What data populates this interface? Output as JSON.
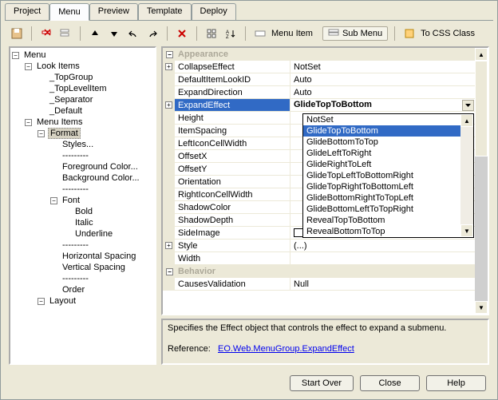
{
  "tabs": [
    "Project",
    "Menu",
    "Preview",
    "Template",
    "Deploy"
  ],
  "activeTab": 1,
  "toolbar": {
    "menuItem": "Menu Item",
    "subMenu": "Sub Menu",
    "toCssClass": "To CSS Class"
  },
  "tree": {
    "root": "Menu",
    "lookItems": {
      "label": "Look Items",
      "children": [
        "_TopGroup",
        "_TopLevelItem",
        "_Separator",
        "_Default"
      ]
    },
    "menuItems": {
      "label": "Menu Items",
      "format": {
        "label": "Format",
        "children": [
          "Styles...",
          "---------",
          "Foreground Color...",
          "Background Color...",
          "---------"
        ],
        "font": {
          "label": "Font",
          "children": [
            "Bold",
            "Italic",
            "Underline"
          ]
        },
        "after": [
          "---------",
          "Horizontal Spacing",
          "Vertical Spacing",
          "---------",
          "Order"
        ]
      },
      "layout": {
        "label": "Layout"
      }
    }
  },
  "props": {
    "catAppearance": "Appearance",
    "catBehavior": "Behavior",
    "rows": {
      "CollapseEffect": "NotSet",
      "DefaultItemLookID": "Auto",
      "ExpandDirection": "Auto",
      "ExpandEffect": "GlideTopToBottom",
      "Height": "",
      "ItemSpacing": "",
      "LeftIconCellWidth": "",
      "OffsetX": "",
      "OffsetY": "",
      "Orientation": "",
      "RightIconCellWidth": "",
      "ShadowColor": "",
      "ShadowDepth": "",
      "SideImage": "",
      "Style": "(...)",
      "Width": "",
      "CausesValidation": "Null"
    },
    "rowLabels": {
      "CollapseEffect": "CollapseEffect",
      "DefaultItemLookID": "DefaultItemLookID",
      "ExpandDirection": "ExpandDirection",
      "ExpandEffect": "ExpandEffect",
      "Height": "Height",
      "ItemSpacing": "ItemSpacing",
      "LeftIconCellWidth": "LeftIconCellWidth",
      "OffsetX": "OffsetX",
      "OffsetY": "OffsetY",
      "Orientation": "Orientation",
      "RightIconCellWidth": "RightIconCellWidth",
      "ShadowColor": "ShadowColor",
      "ShadowDepth": "ShadowDepth",
      "SideImage": "SideImage",
      "Style": "Style",
      "Width": "Width",
      "CausesValidation": "CausesValidation"
    }
  },
  "dropdown": {
    "items": [
      "NotSet",
      "GlideTopToBottom",
      "GlideBottomToTop",
      "GlideLeftToRight",
      "GlideRightToLeft",
      "GlideTopLeftToBottomRight",
      "GlideTopRightToBottomLeft",
      "GlideBottomRightToTopLeft",
      "GlideBottomLeftToTopRight",
      "RevealTopToBottom",
      "RevealBottomToTop"
    ],
    "selectedIndex": 1
  },
  "description": {
    "text": "Specifies the Effect object that controls the effect to expand a submenu.",
    "refLabel": "Reference:",
    "refLink": "EO.Web.MenuGroup.ExpandEffect"
  },
  "buttons": {
    "startOver": "Start Over",
    "close": "Close",
    "help": "Help"
  }
}
